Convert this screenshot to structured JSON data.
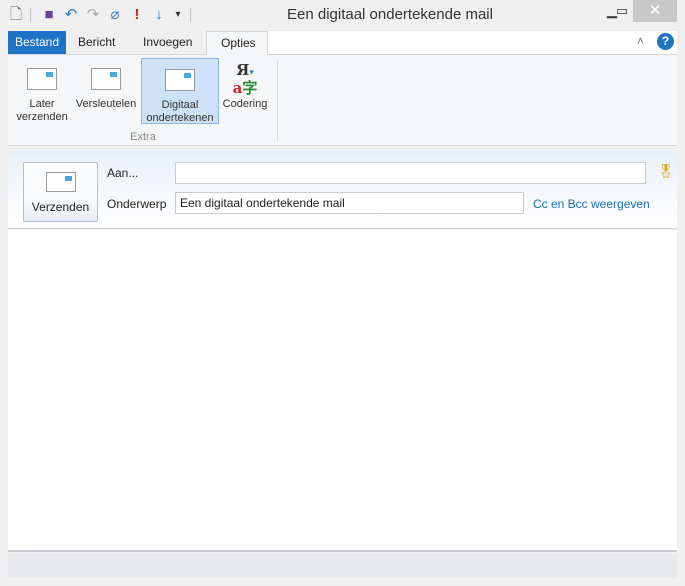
{
  "window": {
    "title": "Een digitaal ondertekende mail"
  },
  "tabs": [
    {
      "label": "Bestand"
    },
    {
      "label": "Bericht"
    },
    {
      "label": "Invoegen"
    },
    {
      "label": "Opties"
    }
  ],
  "ribbon": {
    "buttons": [
      {
        "label1": "Later",
        "label2": "verzenden"
      },
      {
        "label1": "Versleutelen",
        "label2": ""
      },
      {
        "label1": "Digitaal",
        "label2": "ondertekenen"
      },
      {
        "label1": "Codering",
        "label2": ""
      }
    ],
    "group": "Extra"
  },
  "compose": {
    "send_label": "Verzenden",
    "to_label": "Aan...",
    "to_value": "",
    "subject_label": "Onderwerp",
    "subject_value": "Een digitaal ondertekende mail",
    "ccbcc_link": "Cc en Bcc weergeven"
  },
  "colors": {
    "accent": "#1e73c4",
    "link": "#1a6fb8"
  }
}
